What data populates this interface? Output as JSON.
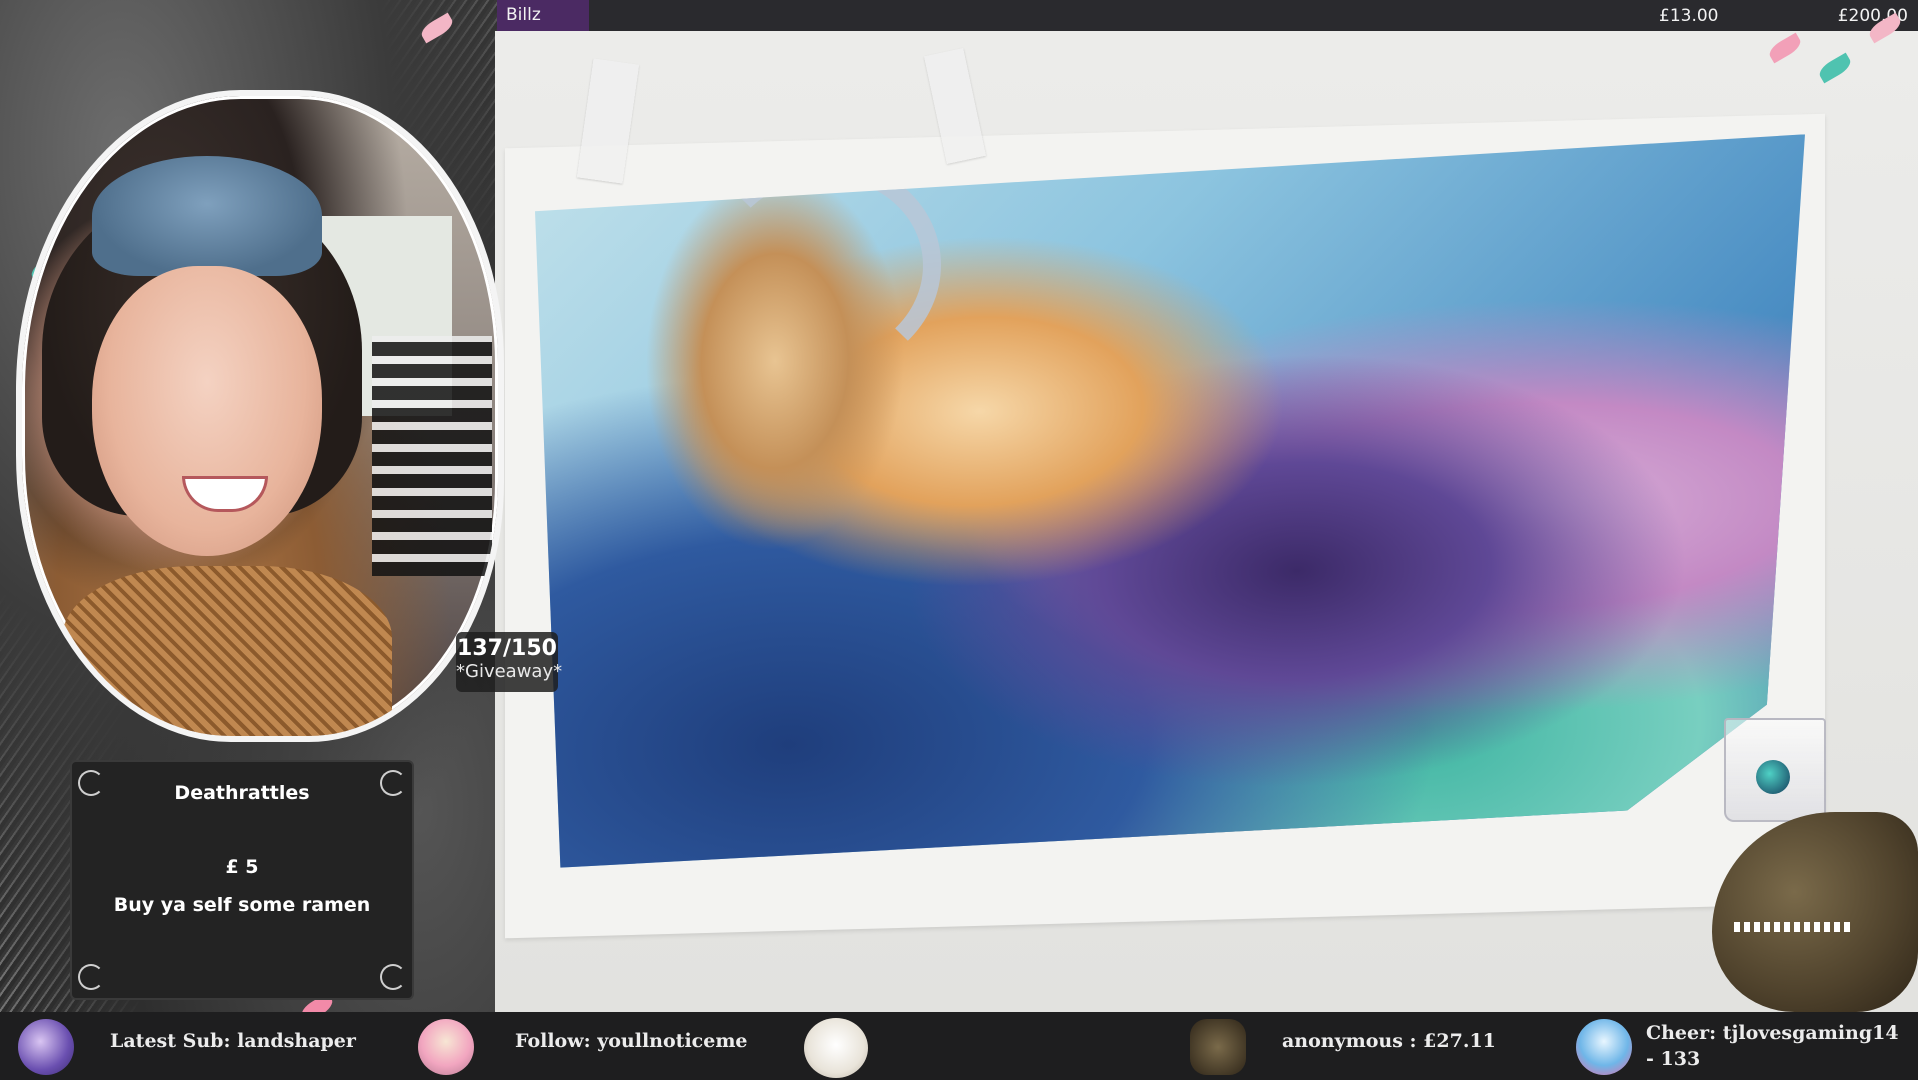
{
  "goal": {
    "name": "Billz",
    "current": "£13.00",
    "target": "£200.00",
    "progress": 0.065
  },
  "giveaway": {
    "count": "137/150",
    "label": "*Giveaway*"
  },
  "alert": {
    "name": "Deathrattles",
    "amount": "£ 5",
    "message": "Buy ya self some ramen"
  },
  "ticker": {
    "latest_sub": "Latest Sub: landshaper",
    "follow": "Follow: youllnoticeme",
    "donation": "anonymous : £27.11",
    "cheer": "Cheer: tjlovesgaming14 - 133"
  },
  "icons": {
    "unicorn": "unicorn-icon",
    "cockatoo": "cockatoo-icon",
    "sheep": "sheep-icon",
    "dinosaur": "dinosaur-icon",
    "parrot": "parrot-icon"
  },
  "colors": {
    "goal_fill": "#4b2a63",
    "bar_bg": "#2a2a2e",
    "ticker_bg": "#1e1e1f",
    "alert_bg": "#232323"
  }
}
